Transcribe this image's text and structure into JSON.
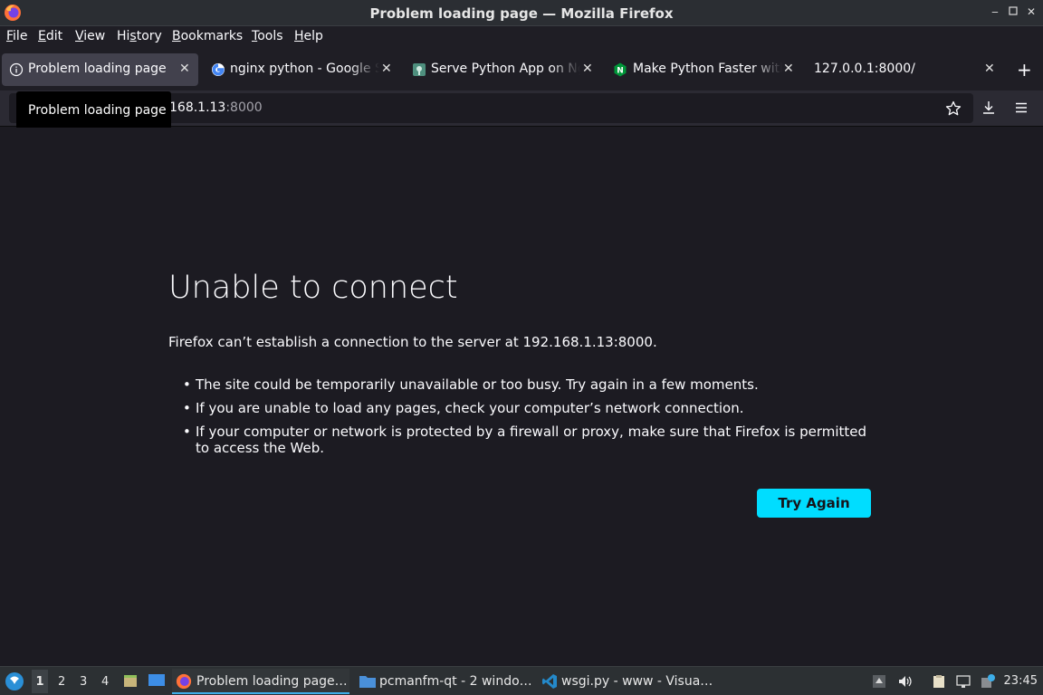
{
  "window": {
    "title": "Problem loading page — Mozilla Firefox"
  },
  "menubar": {
    "items": [
      {
        "label": "File",
        "accel": "F",
        "rest": "ile"
      },
      {
        "label": "Edit",
        "accel": "E",
        "rest": "dit"
      },
      {
        "label": "View",
        "accel": "V",
        "rest": "iew"
      },
      {
        "label": "History",
        "pre": "Hi",
        "accel": "s",
        "rest": "tory"
      },
      {
        "label": "Bookmarks",
        "accel": "B",
        "rest": "ookmarks"
      },
      {
        "label": "Tools",
        "accel": "T",
        "rest": "ools"
      },
      {
        "label": "Help",
        "accel": "H",
        "rest": "elp"
      }
    ]
  },
  "tabs": [
    {
      "label": "Problem loading page",
      "icon": "info-icon",
      "active": true
    },
    {
      "label": "nginx python - Google Search",
      "icon": "google-icon"
    },
    {
      "label": "Serve Python App on Nginx",
      "icon": "site-icon"
    },
    {
      "label": "Make Python Faster with",
      "icon": "nginx-icon"
    },
    {
      "label": "127.0.0.1:8000/",
      "icon": ""
    }
  ],
  "navbar": {
    "url_host": "168.1.13",
    "url_port": ":8000"
  },
  "tooltip": "Problem loading page",
  "error": {
    "title": "Unable to connect",
    "description": "Firefox can’t establish a connection to the server at 192.168.1.13:8000.",
    "reasons": [
      "The site could be temporarily unavailable or too busy. Try again in a few moments.",
      "If you are unable to load any pages, check your computer’s network connection.",
      "If your computer or network is protected by a firewall or proxy, make sure that Firefox is permitted to access the Web."
    ],
    "try_again": "Try Again"
  },
  "taskbar": {
    "workspaces": [
      "1",
      "2",
      "3",
      "4"
    ],
    "tasks": [
      {
        "label": "Problem loading page…",
        "icon": "firefox-icon",
        "active": true
      },
      {
        "label": "pcmanfm-qt - 2 windo…",
        "icon": "folder-icon"
      },
      {
        "label": "wsgi.py - www - Visua…",
        "icon": "vscode-icon"
      }
    ],
    "clock": "23:45"
  },
  "colors": {
    "accent": "#00ddff",
    "background": "#1c1b22",
    "taskbar": "#2c3033"
  }
}
